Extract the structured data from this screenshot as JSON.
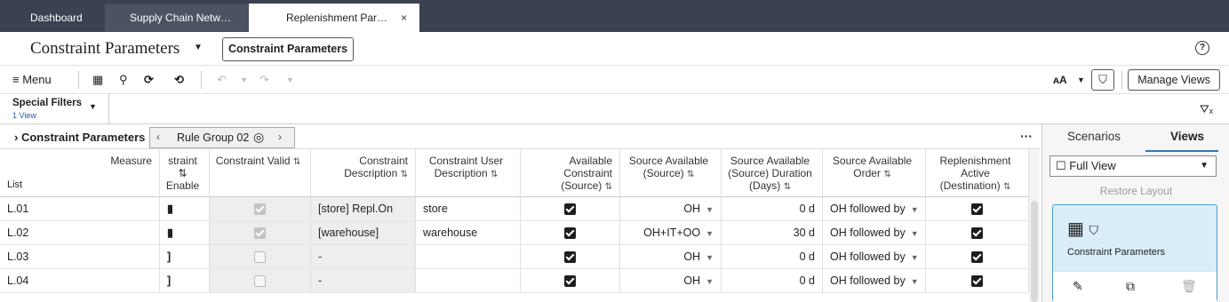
{
  "tabs": [
    {
      "label": "Dashboard"
    },
    {
      "label": "Supply Chain Netw…"
    },
    {
      "label": "Replenishment Par…",
      "close": "×"
    }
  ],
  "title": {
    "text": "Constraint Parameters",
    "chip": "Constraint Parameters"
  },
  "toolbar": {
    "menu_label": "≡ Menu",
    "text_size_label": "ᴀA",
    "manage_views_label": "Manage Views"
  },
  "special_filters": {
    "label": "Special Filters",
    "count": "1 View"
  },
  "panel": {
    "label": "Constraint Parameters",
    "rule_group": "Rule Group 02"
  },
  "grid": {
    "measure_label": "Measure",
    "list_label": "List",
    "headers": {
      "enable": "straint ⇅ Enable",
      "valid": "Constraint Valid",
      "description": "Constraint Description",
      "user_description": "Constraint User Description",
      "available_source": "Available Constraint (Source)",
      "source_available": "Source Available (Source)",
      "duration": "Source Available (Source) Duration (Days)",
      "order": "Source Available Order",
      "replenishment": "Replenishment Active (Destination)"
    },
    "sort_icon": "⇅",
    "rows": [
      {
        "list": "L.01",
        "enable": "▮",
        "valid": true,
        "description": "[store] Repl.On",
        "user_description": "store",
        "available": true,
        "source": "OH",
        "duration": "0 d",
        "order": "OH followed by",
        "replenishment": true
      },
      {
        "list": "L.02",
        "enable": "▮",
        "valid": true,
        "description": "[warehouse]",
        "user_description": "warehouse",
        "available": true,
        "source": "OH+IT+OO",
        "duration": "30 d",
        "order": "OH followed by",
        "replenishment": true
      },
      {
        "list": "L.03",
        "enable": "]",
        "valid": false,
        "description": "-",
        "user_description": "",
        "available": true,
        "source": "OH",
        "duration": "0 d",
        "order": "OH followed by",
        "replenishment": true
      },
      {
        "list": "L.04",
        "enable": "]",
        "valid": false,
        "description": "-",
        "user_description": "",
        "available": true,
        "source": "OH",
        "duration": "0 d",
        "order": "OH followed by",
        "replenishment": true
      }
    ]
  },
  "right_panel": {
    "tab_scenarios": "Scenarios",
    "tab_views": "Views",
    "view_select": "☐ Full View",
    "restore_layout": "Restore Layout",
    "card_label": "Constraint Parameters"
  }
}
